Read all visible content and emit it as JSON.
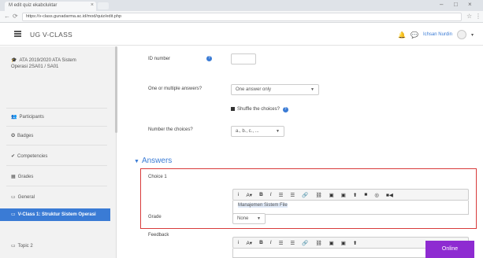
{
  "browser": {
    "tab_title": "M edit quiz ekabcluktar",
    "window_controls": [
      "–",
      "□",
      "×"
    ],
    "url": "https://v-class.gunadarma.ac.id/mod/quiz/edit.php"
  },
  "navbar": {
    "brand": "UG V-CLASS",
    "username": "Ichsan Nurdin"
  },
  "sidebar": {
    "items": [
      {
        "label": "ATA 2019/2020 ATA Sistem Operasi 2SA01 / SA01",
        "icon": "cap"
      },
      {
        "label": "Participants",
        "icon": "users"
      },
      {
        "label": "Badges",
        "icon": "badge"
      },
      {
        "label": "Competencies",
        "icon": "check"
      },
      {
        "label": "Grades",
        "icon": "grid"
      },
      {
        "label": "General",
        "icon": "folder"
      },
      {
        "label": "V-Class 1: Struktur Sistem Operasi",
        "icon": "folder"
      },
      {
        "label": "Topic 2",
        "icon": "folder"
      }
    ]
  },
  "form": {
    "id_number_label": "ID number",
    "one_multiple_label": "One or multiple answers?",
    "one_multiple_value": "One answer only",
    "shuffle_label": "Shuffle the choices?",
    "numbering_label": "Number the choices?",
    "numbering_value": "a., b., c., ...",
    "answers_heading": "Answers",
    "choice1_label": "Choice 1",
    "choice1_text": "Manajemen Sistem File",
    "grade_label": "Grade",
    "grade_value": "None",
    "feedback_label": "Feedback",
    "toolbar_buttons": [
      "i",
      "A▾",
      "B",
      "I",
      "☰",
      "☰",
      "🔗",
      "⛓",
      "▣",
      "▣",
      "⬆",
      "■",
      "◎",
      "■◀"
    ]
  },
  "status": {
    "online": "Online"
  },
  "colors": {
    "accent": "#3a7bd5",
    "highlight_border": "#d83b3b",
    "online_bg": "#8e2bd1"
  }
}
